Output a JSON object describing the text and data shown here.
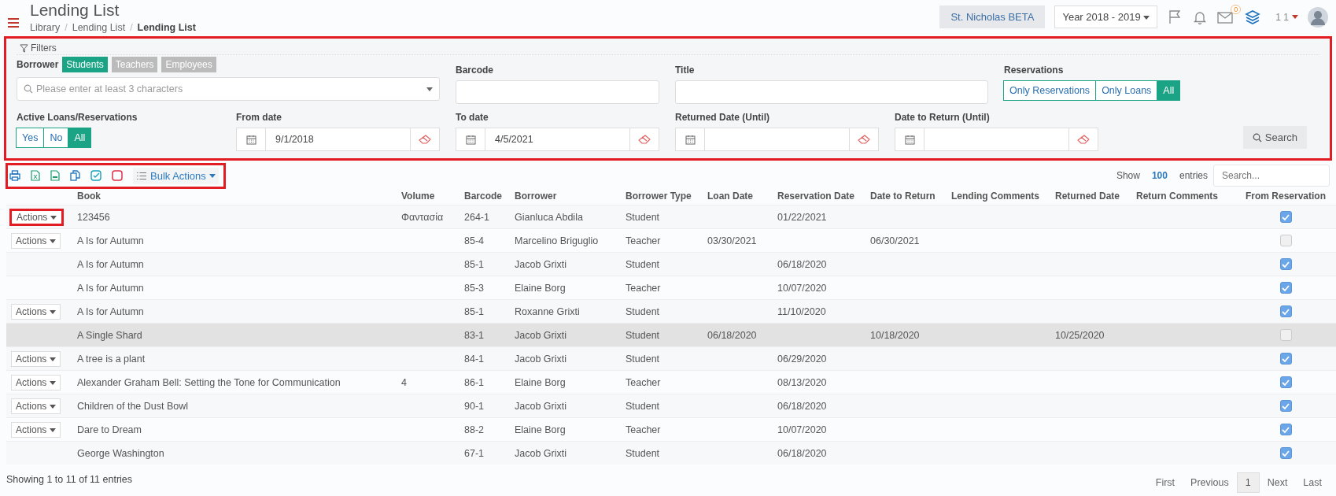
{
  "header": {
    "title": "Lending List",
    "breadcrumbs": [
      {
        "label": "Library",
        "separator": "/"
      },
      {
        "label": "Lending List",
        "separator": "/"
      },
      {
        "label": "Lending List"
      }
    ],
    "school": "St. Nicholas BETA",
    "year": "Year 2018 - 2019",
    "mail_count": "0",
    "user": "1 1"
  },
  "filters": {
    "highlighted": true,
    "legend": "Filters",
    "borrower_label": "Borrower",
    "borrower_types": [
      {
        "label": "Students",
        "selected": true
      },
      {
        "label": "Teachers",
        "selected": false
      },
      {
        "label": "Employees",
        "selected": false
      }
    ],
    "borrower_placeholder": "Please enter at least 3 characters",
    "barcode_label": "Barcode",
    "title_label": "Title",
    "reservations_label": "Reservations",
    "reservations": [
      {
        "label": "Only Reservations",
        "selected": false
      },
      {
        "label": "Only Loans",
        "selected": false
      },
      {
        "label": "All",
        "selected": true
      }
    ],
    "active_label": "Active Loans/Reservations",
    "active": [
      {
        "label": "Yes",
        "selected": false
      },
      {
        "label": "No",
        "selected": false
      },
      {
        "label": "All",
        "selected": true
      }
    ],
    "dates": [
      {
        "label": "From date",
        "value": "9/1/2018"
      },
      {
        "label": "To date",
        "value": "4/5/2021"
      },
      {
        "label": "Returned Date (Until)"
      },
      {
        "label": "Date to Return (Until)"
      }
    ],
    "search_button": "Search"
  },
  "toolbar": {
    "highlighted": true,
    "bulk_actions": "Bulk Actions",
    "show_label": "Show",
    "entries_count": "100",
    "entries_label": "entries",
    "search_placeholder": "Search..."
  },
  "table": {
    "columns": [
      "Book",
      "Volume",
      "Barcode",
      "Borrower",
      "Borrower Type",
      "Loan Date",
      "Reservation Date",
      "Date to Return",
      "Lending Comments",
      "Returned Date",
      "Return Comments",
      "From Reservation"
    ],
    "rows": [
      {
        "actions": {
          "label": "Actions",
          "highlighted": true
        },
        "selected": false,
        "from_reservation": true,
        "cells": [
          "123456",
          "Φαντασία",
          "264-1",
          "Gianluca Abdila",
          "Student",
          "",
          "01/22/2021",
          "",
          "",
          "",
          ""
        ]
      },
      {
        "actions": {
          "label": "Actions",
          "highlighted": false
        },
        "selected": false,
        "from_reservation": false,
        "cells": [
          "A Is for Autumn",
          "",
          "85-4",
          "Marcelino Briguglio",
          "Teacher",
          "03/30/2021",
          "",
          "06/30/2021",
          "",
          "",
          ""
        ]
      },
      {
        "selected": false,
        "from_reservation": true,
        "cells": [
          "A Is for Autumn",
          "",
          "85-1",
          "Jacob Grixti",
          "Student",
          "",
          "06/18/2020",
          "",
          "",
          "",
          ""
        ]
      },
      {
        "selected": false,
        "from_reservation": true,
        "cells": [
          "A Is for Autumn",
          "",
          "85-3",
          "Elaine Borg",
          "Teacher",
          "",
          "10/07/2020",
          "",
          "",
          "",
          ""
        ]
      },
      {
        "actions": {
          "label": "Actions",
          "highlighted": false
        },
        "selected": false,
        "from_reservation": true,
        "cells": [
          "A Is for Autumn",
          "",
          "85-1",
          "Roxanne Grixti",
          "Student",
          "",
          "11/10/2020",
          "",
          "",
          "",
          ""
        ]
      },
      {
        "selected": true,
        "from_reservation": false,
        "cells": [
          "A Single Shard",
          "",
          "83-1",
          "Jacob Grixti",
          "Student",
          "06/18/2020",
          "",
          "10/18/2020",
          "",
          "10/25/2020",
          ""
        ]
      },
      {
        "actions": {
          "label": "Actions",
          "highlighted": false
        },
        "selected": false,
        "from_reservation": true,
        "cells": [
          "A tree is a plant",
          "",
          "84-1",
          "Jacob Grixti",
          "Student",
          "",
          "06/29/2020",
          "",
          "",
          "",
          ""
        ]
      },
      {
        "actions": {
          "label": "Actions",
          "highlighted": false
        },
        "selected": false,
        "from_reservation": true,
        "cells": [
          "Alexander Graham Bell: Setting the Tone for Communication",
          "4",
          "86-1",
          "Elaine Borg",
          "Teacher",
          "",
          "08/13/2020",
          "",
          "",
          "",
          ""
        ]
      },
      {
        "actions": {
          "label": "Actions",
          "highlighted": false
        },
        "selected": false,
        "from_reservation": true,
        "cells": [
          "Children of the Dust Bowl",
          "",
          "90-1",
          "Jacob Grixti",
          "Student",
          "",
          "06/18/2020",
          "",
          "",
          "",
          ""
        ]
      },
      {
        "actions": {
          "label": "Actions",
          "highlighted": false
        },
        "selected": false,
        "from_reservation": true,
        "cells": [
          "Dare to Dream",
          "",
          "88-2",
          "Elaine Borg",
          "Teacher",
          "",
          "10/07/2020",
          "",
          "",
          "",
          ""
        ]
      },
      {
        "selected": false,
        "from_reservation": true,
        "cells": [
          "George Washington",
          "",
          "67-1",
          "Jacob Grixti",
          "Student",
          "",
          "06/18/2020",
          "",
          "",
          "",
          ""
        ]
      }
    ]
  },
  "footer": {
    "info": "Showing 1 to 11 of 11 entries",
    "pagination": [
      {
        "label": "First",
        "selected": false
      },
      {
        "label": "Previous",
        "selected": false
      },
      {
        "label": "1",
        "selected": true
      },
      {
        "label": "Next",
        "selected": false
      },
      {
        "label": "Last",
        "selected": false
      }
    ]
  }
}
